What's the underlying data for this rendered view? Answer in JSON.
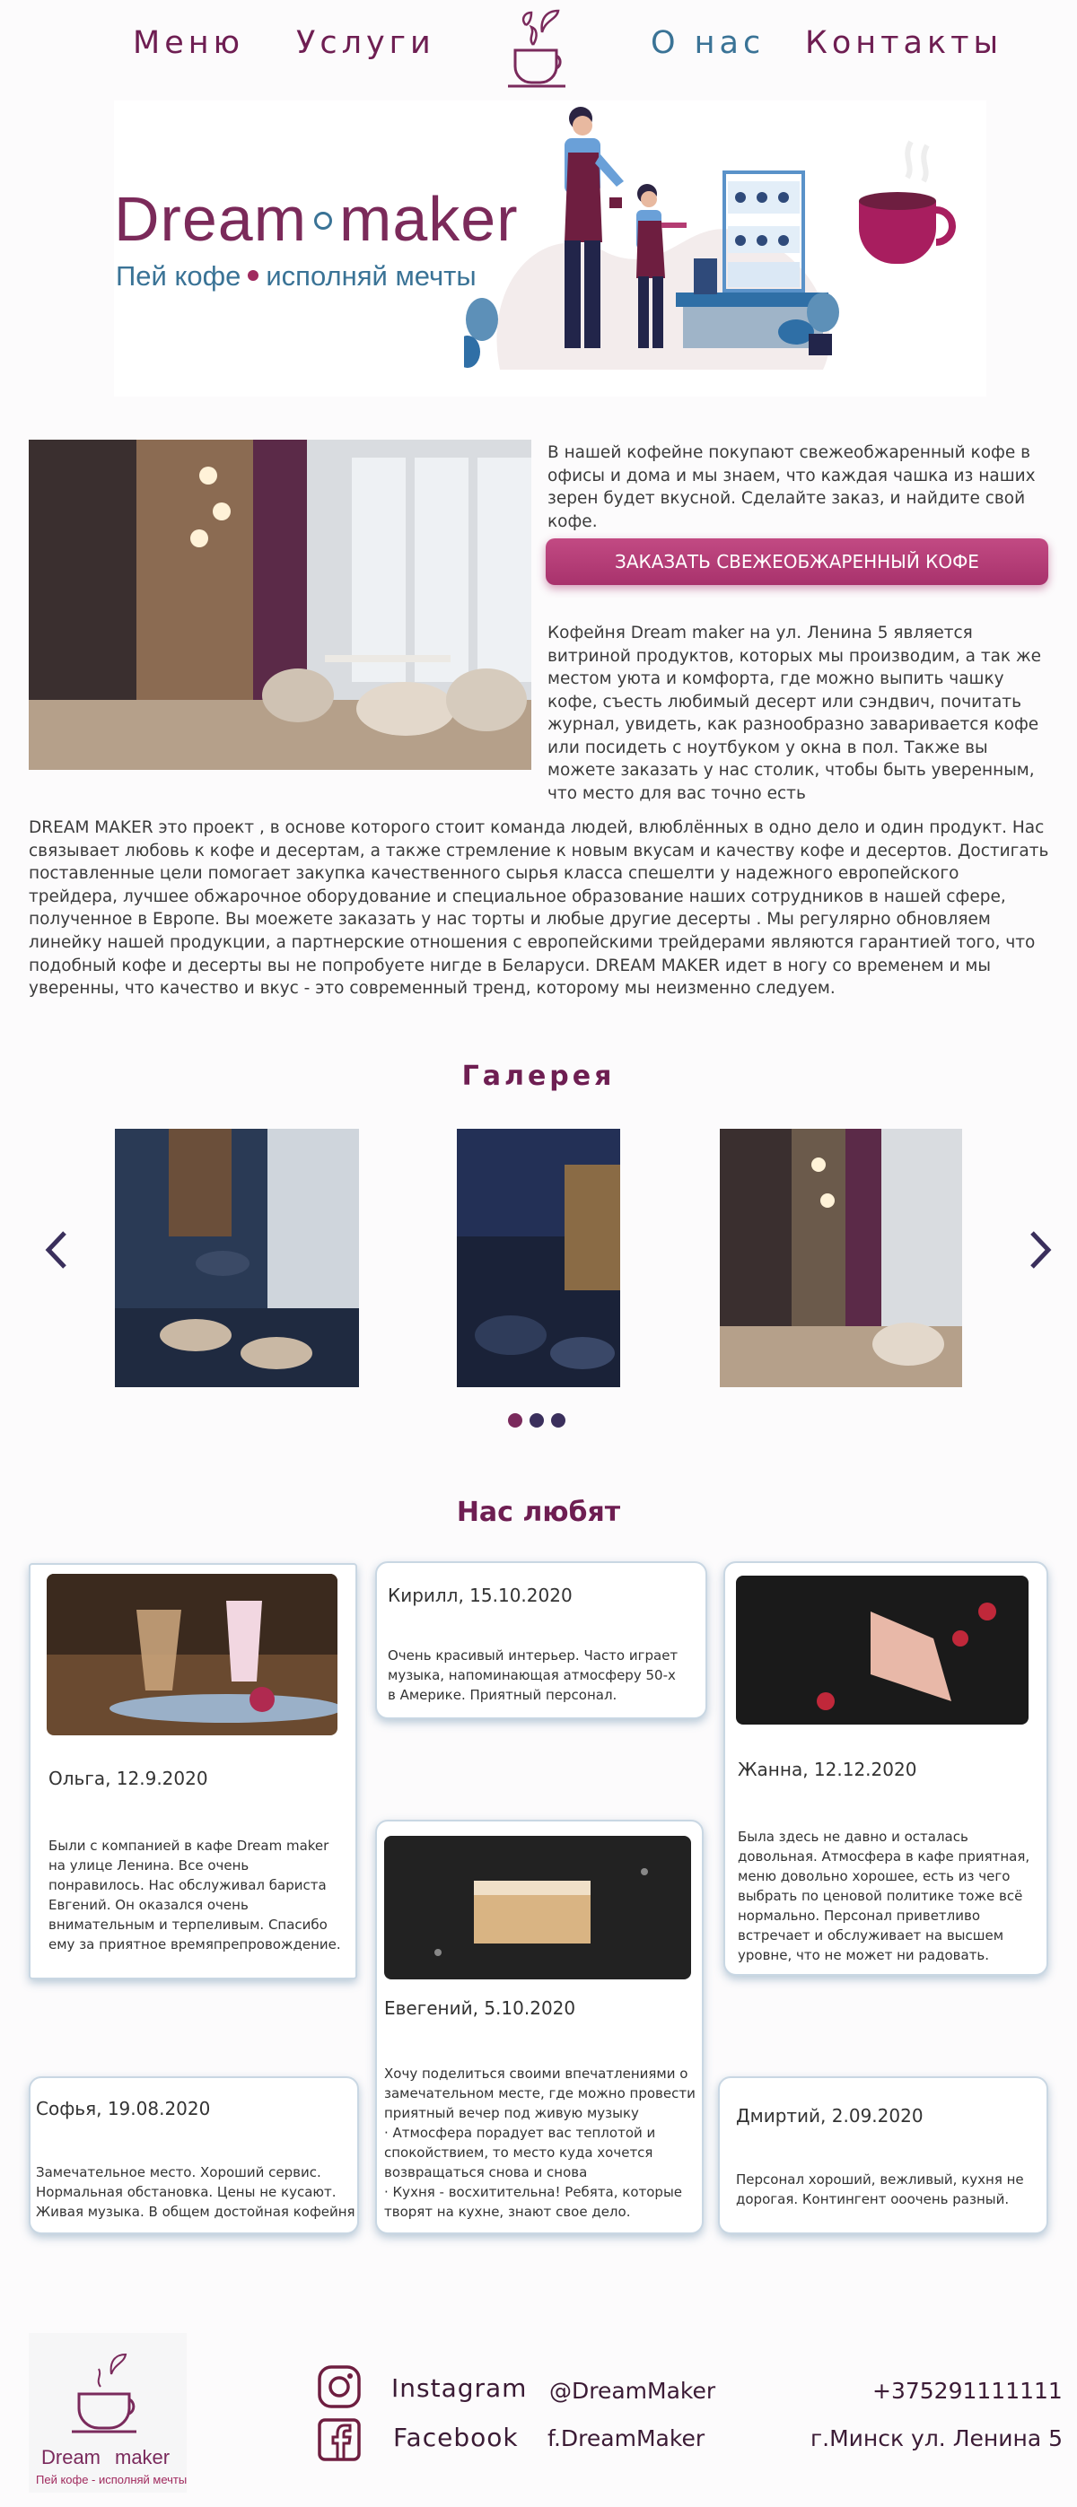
{
  "nav": {
    "menu": "Меню",
    "services": "Услуги",
    "about": "О нас",
    "contacts": "Контакты"
  },
  "hero": {
    "brand_left": "Dream",
    "brand_right": "maker",
    "tagline_left": "Пей кофе",
    "tagline_right": "исполняй мечты"
  },
  "intro": {
    "paragraph1": "В нашей кофейне покупают свежеобжаренный кофе в офисы и дома и мы знаем, что каждая чашка из наших зерен будет вкусной. Сделайте заказ, и найдите свой кофе.",
    "order_button": "ЗАКАЗАТЬ СВЕЖЕОБЖАРЕННЫЙ КОФЕ",
    "paragraph2": "Кофейня Dream maker на ул. Ленина 5 является витриной продуктов, которых мы производим, а так же местом уюта и комфорта, где можно выпить чашку кофе, съесть любимый десерт или сэндвич, почитать журнал, увидеть, как разнообразно заваривается кофе или посидеть с ноутбуком у окна в пол. Также вы можете заказать у нас столик, чтобы быть уверенным, что место для вас точно есть",
    "about": "DREAM MAKER это проект , в основе которого стоит команда людей, влюблённых в одно дело и один продукт. Нас связывает любовь к кофе и десертам, а также стремление к новым вкусам и качеству кофе и десертов. Достигать поставленные цели помогает закупка качественного сырья класса спешелти у надежного европейского трейдера, лучшее обжарочное оборудование и специальное образование наших сотрудников в нашей сфере, полученное в Европе. Вы моежете заказать у нас торты и любые другие десерты . Мы регулярно обновляем линейку нашей продукции, а партнерские отношения с европейскими трейдерами являются гарантией того, что подобный кофе и десерты вы не попробуете нигде в Беларуси. DREAM MAKER идет в ногу со временем и мы уверенны, что качество и вкус - это современный тренд, которому мы неизменно следуем."
  },
  "gallery": {
    "title": "Галерея",
    "dot_colors": [
      "#7a2a5c",
      "#3a2f5c",
      "#3a2f5c"
    ]
  },
  "reviews": {
    "title": "Нас любят",
    "items": [
      {
        "name": "Ольга, 12.9.2020",
        "text": "Были с компанией в кафе Dream maker на улице Ленина. Все очень понравилось. Нас обслуживал бариста Евгений. Он оказался очень внимательным и терпеливым. Спасибо ему за приятное времяпрепровождение."
      },
      {
        "name": "Кирилл, 15.10.2020",
        "text": "Очень красивый интерьер. Часто играет музыка, напоминающая атмосферу 50-х в Америке. Приятный персонал."
      },
      {
        "name": "Жанна, 12.12.2020",
        "text": "Была здесь не давно и осталась довольная. Атмосфера в кафе приятная, меню довольно хорошее, есть из чего выбрать по ценовой политике тоже всё нормально. Персонал приветливо встречает и обслуживает на высшем уровне, что не может ни радовать."
      },
      {
        "name": "Евегений, 5.10.2020",
        "text": "Хочу поделиться своими впечатлениями о замечательном месте, где можно провести приятный вечер под живую музыку\n· Атмосфера порадует вас теплотой и спокойствием, то место куда хочется возвращаться снова и снова\n· Кухня - восхитительна! Ребята, которые творят на кухне, знают свое дело."
      },
      {
        "name": "Софья, 19.08.2020",
        "text": "Замечательное место. Хороший сервис. Нормальная обстановка. Цены не кусают. Живая музыка. В общем достойная кофейня"
      },
      {
        "name": "Дмиртий, 2.09.2020",
        "text": "Персонал хороший, вежливый, кухня не дорогая. Контингент ооочень разный."
      }
    ]
  },
  "footer": {
    "logo_name_left": "Dream",
    "logo_name_right": "maker",
    "logo_tagline": "Пей кофе - исполняй мечты",
    "instagram_label": "Instagram",
    "instagram_handle": "@DreamMaker",
    "facebook_label": "Facebook",
    "facebook_handle": "f.DreamMaker",
    "phone": "+375291111111",
    "address": "г.Минск ул. Ленина 5"
  },
  "colors": {
    "brand_plum": "#6e1e52",
    "brand_blue": "#3a7396",
    "button_pink": "#b93a77"
  }
}
